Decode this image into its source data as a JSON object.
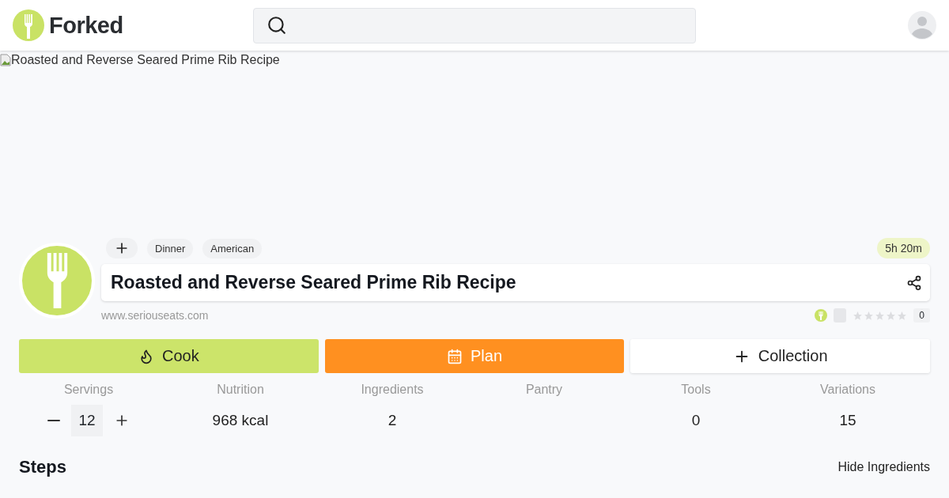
{
  "header": {
    "logo": "Forked"
  },
  "image": {
    "alt": "Roasted and Reverse Seared Prime Rib Recipe"
  },
  "tags": [
    "Dinner",
    "American"
  ],
  "time": "5h 20m",
  "title": "Roasted and Reverse Seared Prime Rib Recipe",
  "source": "www.seriouseats.com",
  "rating": {
    "stars": 0,
    "count": "0"
  },
  "actions": [
    {
      "kind": "cook",
      "label": "Cook"
    },
    {
      "kind": "plan",
      "label": "Plan"
    },
    {
      "kind": "collection",
      "label": "Collection"
    }
  ],
  "stats": [
    {
      "kind": "stepper",
      "label": "Servings",
      "value": "12"
    },
    {
      "kind": "text",
      "label": "Nutrition",
      "value": "968 kcal"
    },
    {
      "kind": "text",
      "label": "Ingredients",
      "value": "2"
    },
    {
      "kind": "text",
      "label": "Pantry"
    },
    {
      "kind": "text",
      "label": "Tools",
      "value": "0"
    },
    {
      "kind": "text",
      "label": "Variations",
      "value": "15"
    }
  ],
  "steps_heading": "Steps",
  "hide_ingredients": "Hide Ingredients"
}
